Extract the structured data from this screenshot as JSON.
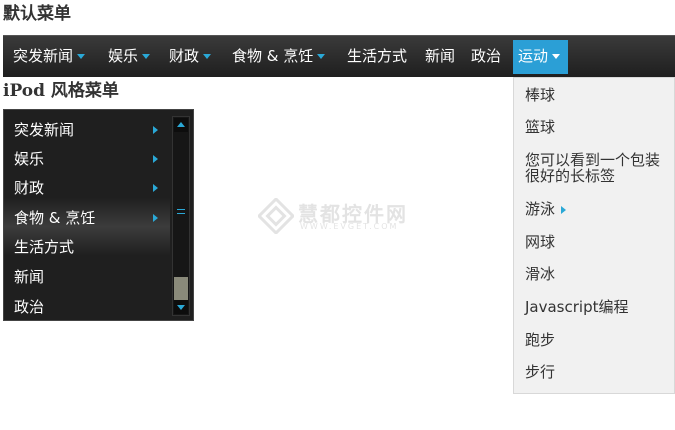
{
  "titles": {
    "default_menu": "默认菜单",
    "ipod_menu": "iPod 风格菜单"
  },
  "menubar": {
    "items": [
      {
        "label": "突发新闻",
        "has_submenu": true,
        "active": false
      },
      {
        "label": "娱乐",
        "has_submenu": true,
        "active": false
      },
      {
        "label": "财政",
        "has_submenu": true,
        "active": false
      },
      {
        "label": "食物 & 烹饪",
        "has_submenu": true,
        "active": false
      },
      {
        "label": "生活方式",
        "has_submenu": false,
        "active": false
      },
      {
        "label": "新闻",
        "has_submenu": false,
        "active": false
      },
      {
        "label": "政治",
        "has_submenu": false,
        "active": false
      },
      {
        "label": "运动",
        "has_submenu": true,
        "active": true
      }
    ]
  },
  "dropdown": {
    "items": [
      {
        "label": "棒球",
        "has_submenu": false
      },
      {
        "label": "篮球",
        "has_submenu": false
      },
      {
        "label": "您可以看到一个包装很好的长标签",
        "has_submenu": false
      },
      {
        "label": "游泳",
        "has_submenu": true
      },
      {
        "label": "网球",
        "has_submenu": false
      },
      {
        "label": "滑冰",
        "has_submenu": false
      },
      {
        "label": "Javascript编程",
        "has_submenu": false
      },
      {
        "label": "跑步",
        "has_submenu": false
      },
      {
        "label": "步行",
        "has_submenu": false
      }
    ]
  },
  "ipod": {
    "items": [
      {
        "label": "突发新闻",
        "has_submenu": true
      },
      {
        "label": "娱乐",
        "has_submenu": true
      },
      {
        "label": "财政",
        "has_submenu": true
      },
      {
        "label": "食物 & 烹饪",
        "has_submenu": true
      },
      {
        "label": "生活方式",
        "has_submenu": false
      },
      {
        "label": "新闻",
        "has_submenu": false
      },
      {
        "label": "政治",
        "has_submenu": false
      }
    ]
  },
  "watermark": {
    "text": "慧都控件网",
    "url": "WWW.EVGET.COM"
  },
  "colors": {
    "accent": "#2aa8d6",
    "active_tab": "#2b9fd6",
    "menubar_bg": "#262626",
    "dropdown_bg": "#f1f1f1"
  }
}
